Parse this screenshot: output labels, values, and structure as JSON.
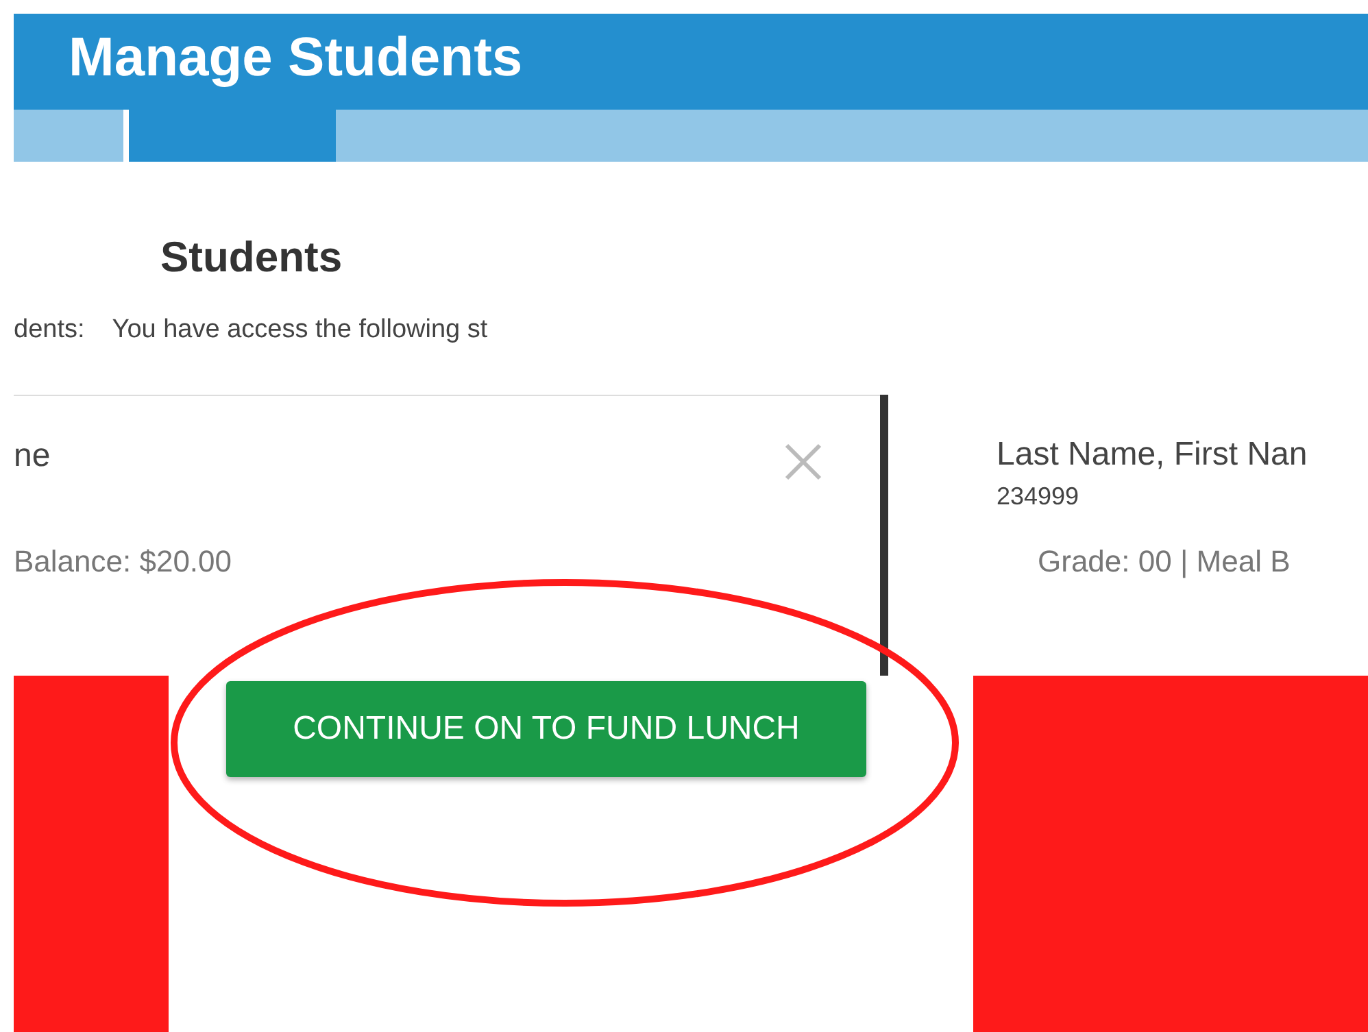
{
  "header": {
    "title": "Manage Students"
  },
  "tabs": [
    {
      "selected": false
    },
    {
      "selected": true
    },
    {
      "selected": false
    }
  ],
  "section": {
    "heading": "Students",
    "intro_left": "dents:",
    "intro": "You have access the following st"
  },
  "cards": [
    {
      "name": "ne",
      "detail": "Balance: $20.00",
      "closable": true
    },
    {
      "name": "Last Name, First Nan",
      "id": "234999",
      "detail": "Grade: 00 | Meal B",
      "closable": false
    }
  ],
  "continue_button": {
    "label": "CONTINUE ON TO FUND LUNCH"
  }
}
